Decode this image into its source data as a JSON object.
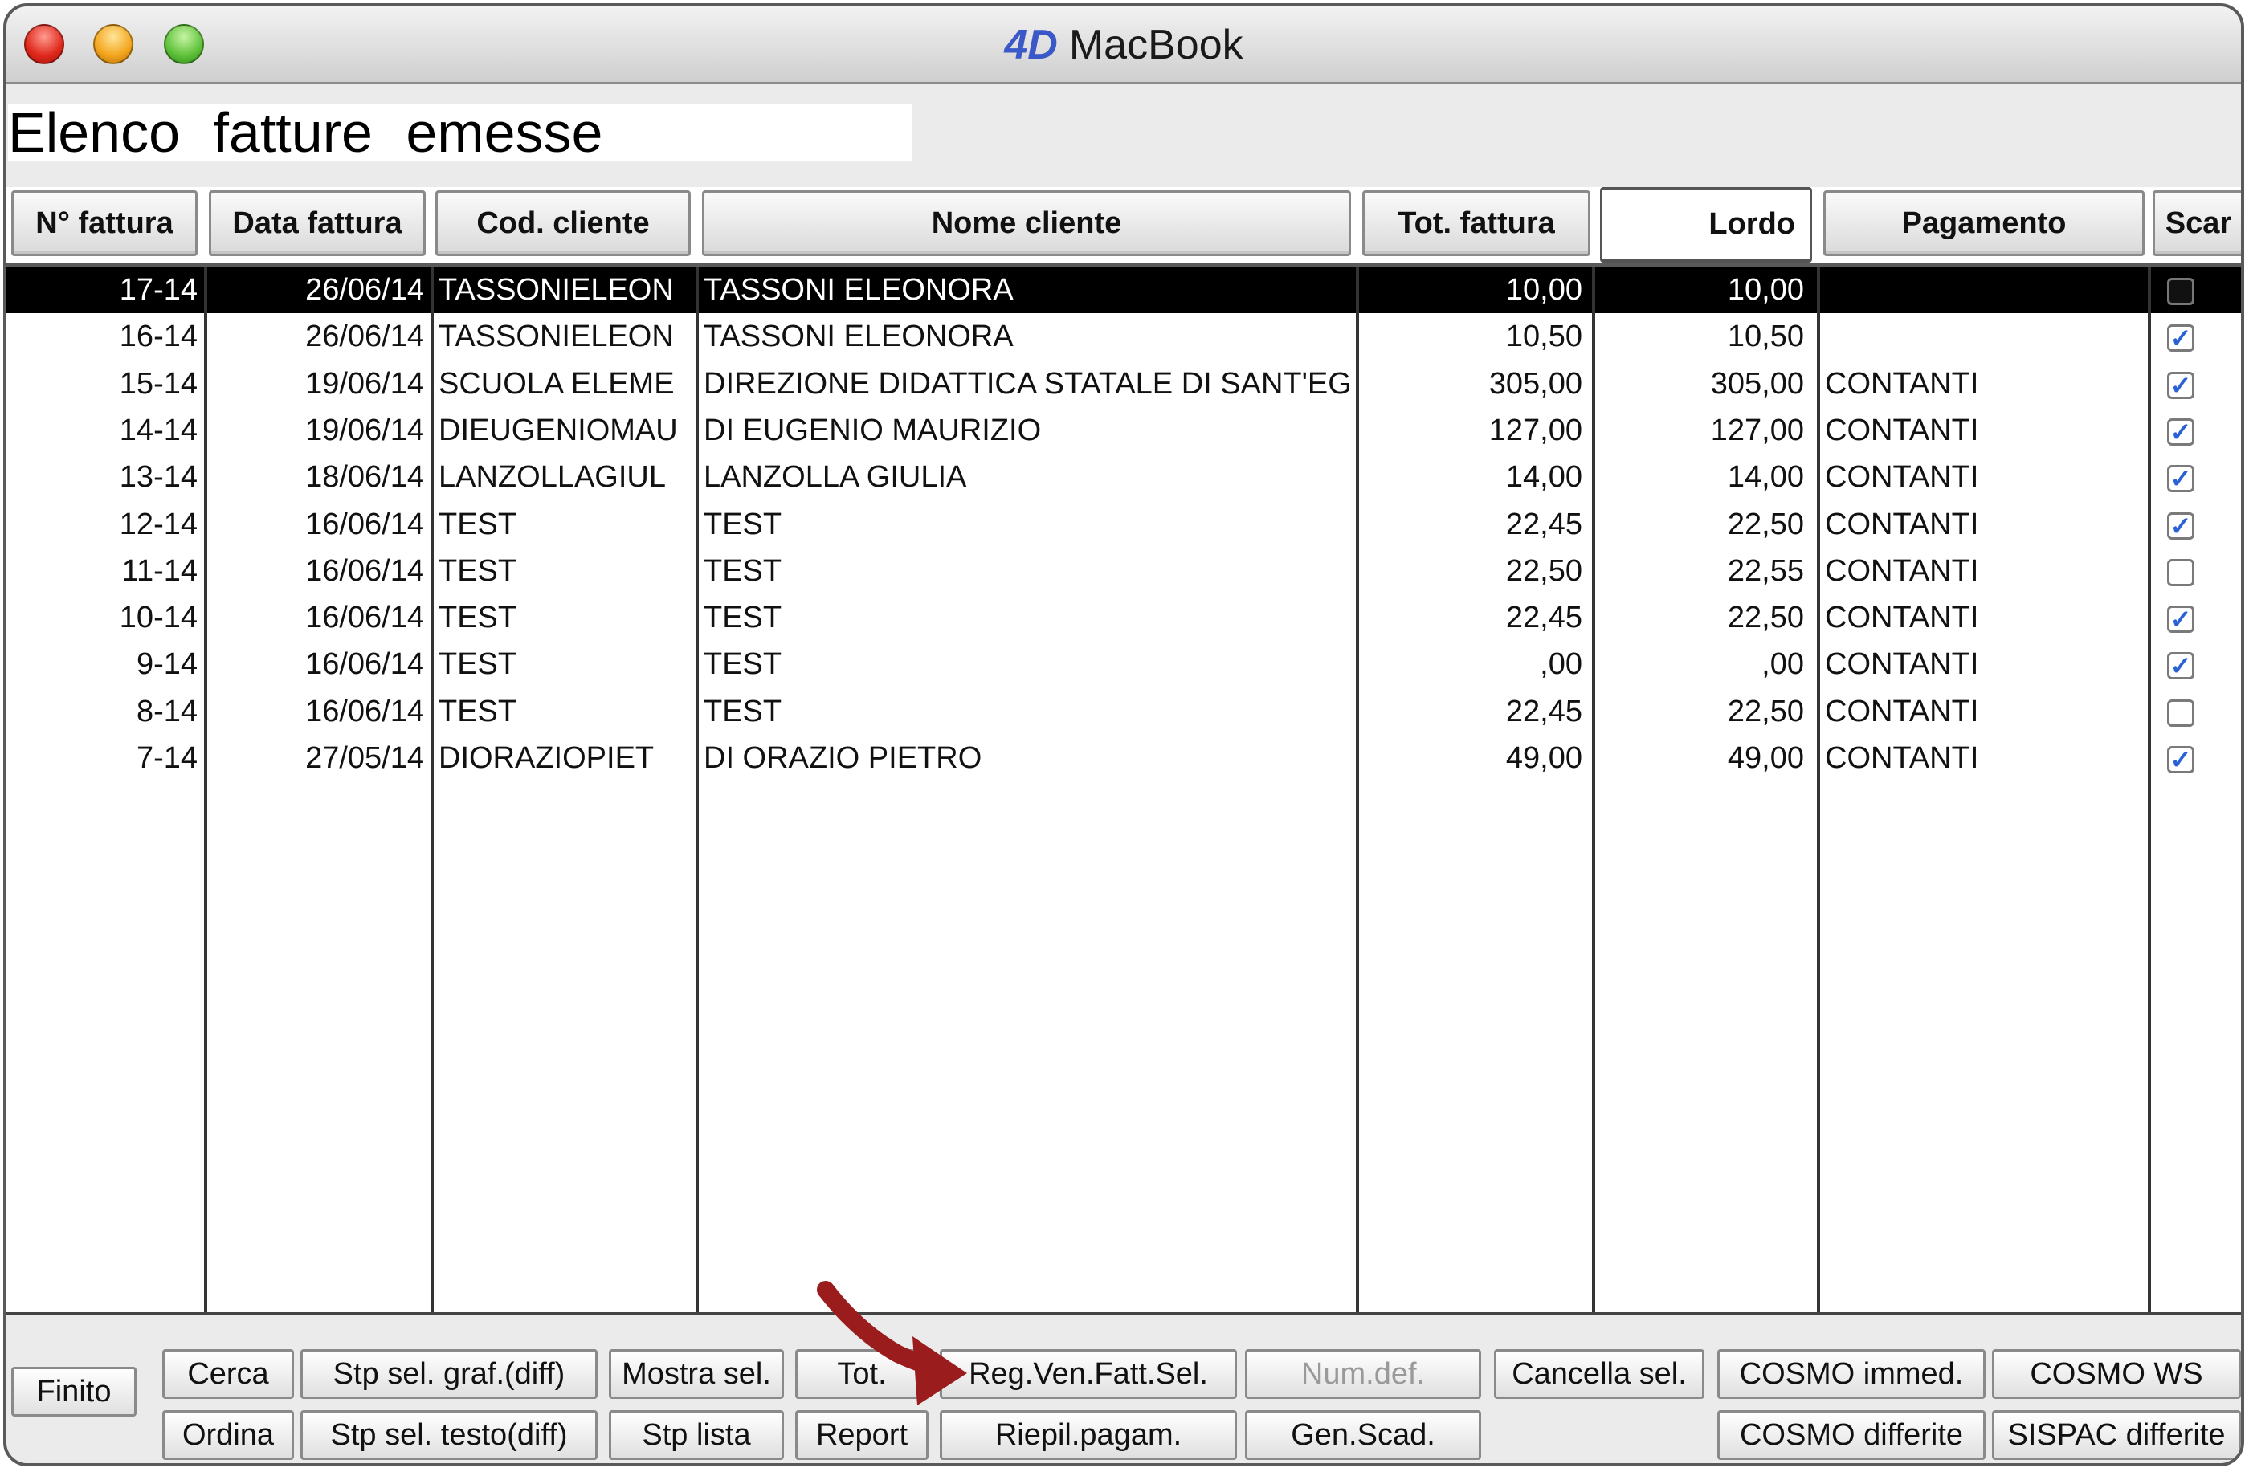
{
  "window": {
    "title": "MacBook"
  },
  "page_title": "Elenco fatture emesse",
  "columns": {
    "num": "N° fattura",
    "data": "Data fattura",
    "cod": "Cod. cliente",
    "nome": "Nome cliente",
    "tot": "Tot. fattura",
    "lordo": "Lordo",
    "pag": "Pagamento",
    "scar": "Scar"
  },
  "rows": [
    {
      "num": "17-14",
      "data": "26/06/14",
      "cod": "TASSONIELEON",
      "nome": "TASSONI ELEONORA",
      "tot": "10,00",
      "lordo": "10,00",
      "pag": "",
      "scar": false,
      "selected": true
    },
    {
      "num": "16-14",
      "data": "26/06/14",
      "cod": "TASSONIELEON",
      "nome": "TASSONI ELEONORA",
      "tot": "10,50",
      "lordo": "10,50",
      "pag": "",
      "scar": true,
      "selected": false
    },
    {
      "num": "15-14",
      "data": "19/06/14",
      "cod": "SCUOLA ELEME",
      "nome": "DIREZIONE DIDATTICA STATALE DI SANT'EG",
      "tot": "305,00",
      "lordo": "305,00",
      "pag": "CONTANTI",
      "scar": true,
      "selected": false
    },
    {
      "num": "14-14",
      "data": "19/06/14",
      "cod": "DIEUGENIOMAU",
      "nome": "DI EUGENIO MAURIZIO",
      "tot": "127,00",
      "lordo": "127,00",
      "pag": "CONTANTI",
      "scar": true,
      "selected": false
    },
    {
      "num": "13-14",
      "data": "18/06/14",
      "cod": "LANZOLLAGIUL",
      "nome": "LANZOLLA GIULIA",
      "tot": "14,00",
      "lordo": "14,00",
      "pag": "CONTANTI",
      "scar": true,
      "selected": false
    },
    {
      "num": "12-14",
      "data": "16/06/14",
      "cod": "TEST",
      "nome": "TEST",
      "tot": "22,45",
      "lordo": "22,50",
      "pag": "CONTANTI",
      "scar": true,
      "selected": false
    },
    {
      "num": "11-14",
      "data": "16/06/14",
      "cod": "TEST",
      "nome": "TEST",
      "tot": "22,50",
      "lordo": "22,55",
      "pag": "CONTANTI",
      "scar": false,
      "selected": false
    },
    {
      "num": "10-14",
      "data": "16/06/14",
      "cod": "TEST",
      "nome": "TEST",
      "tot": "22,45",
      "lordo": "22,50",
      "pag": "CONTANTI",
      "scar": true,
      "selected": false
    },
    {
      "num": "9-14",
      "data": "16/06/14",
      "cod": "TEST",
      "nome": "TEST",
      "tot": ",00",
      "lordo": ",00",
      "pag": "CONTANTI",
      "scar": true,
      "selected": false
    },
    {
      "num": "8-14",
      "data": "16/06/14",
      "cod": "TEST",
      "nome": "TEST",
      "tot": "22,45",
      "lordo": "22,50",
      "pag": "CONTANTI",
      "scar": false,
      "selected": false
    },
    {
      "num": "7-14",
      "data": "27/05/14",
      "cod": "DIORAZIOPIET",
      "nome": "DI ORAZIO PIETRO",
      "tot": "49,00",
      "lordo": "49,00",
      "pag": "CONTANTI",
      "scar": true,
      "selected": false
    }
  ],
  "buttons": {
    "finito": "Finito",
    "cerca": "Cerca",
    "ordina": "Ordina",
    "stp_graf": "Stp sel. graf.(diff)",
    "stp_testo": "Stp sel. testo(diff)",
    "mostra_sel": "Mostra sel.",
    "stp_lista": "Stp lista",
    "tot": "Tot.",
    "report": "Report",
    "reg_ven": "Reg.Ven.Fatt.Sel.",
    "riepil": "Riepil.pagam.",
    "num_def": "Num.def.",
    "gen_scad": "Gen.Scad.",
    "cancella": "Cancella sel.",
    "cosmo_immed": "COSMO immed.",
    "cosmo_differite": "COSMO differite",
    "cosmo_ws": "COSMO WS",
    "sispac": "SISPAC differite"
  },
  "colors": {
    "selection": "#000000",
    "check": "#2a62d6",
    "arrow": "#9b1c1c"
  }
}
